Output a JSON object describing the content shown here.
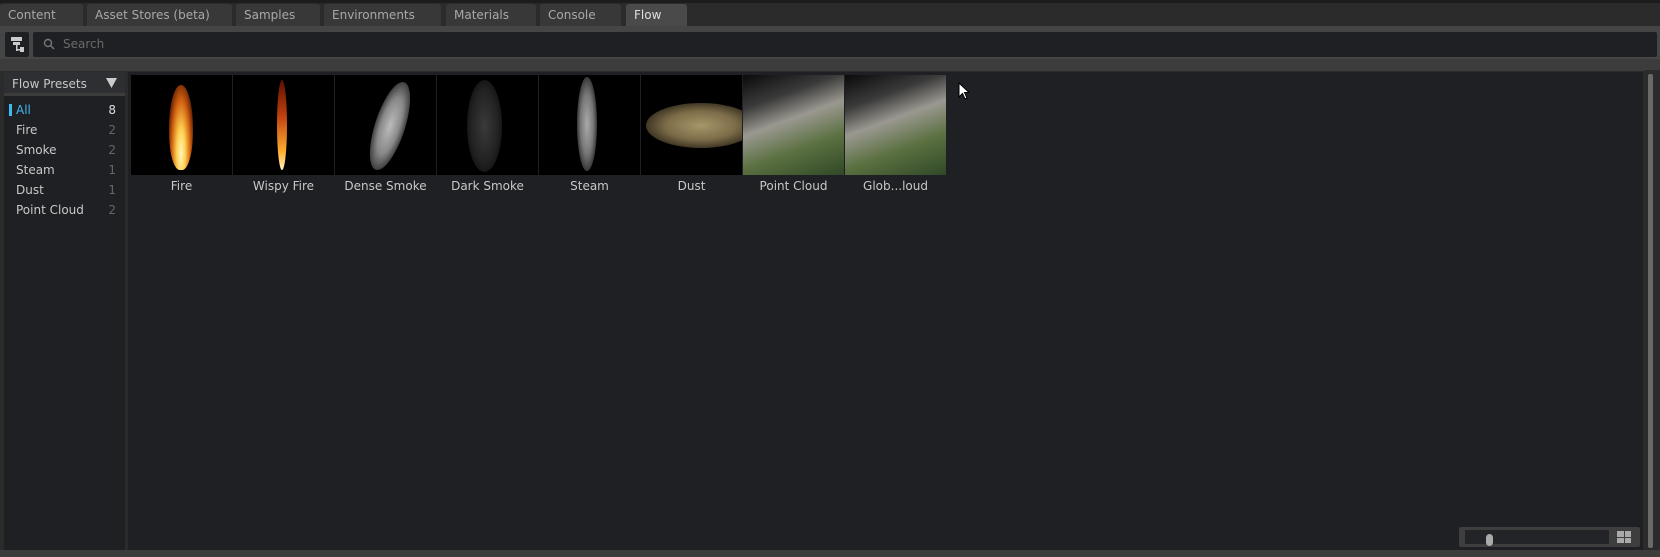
{
  "tabs": [
    {
      "label": "Content",
      "active": false
    },
    {
      "label": "Asset Stores (beta)",
      "active": false
    },
    {
      "label": "Samples",
      "active": false
    },
    {
      "label": "Environments",
      "active": false
    },
    {
      "label": "Materials",
      "active": false
    },
    {
      "label": "Console",
      "active": false
    },
    {
      "label": "Flow",
      "active": true
    }
  ],
  "search": {
    "placeholder": "Search",
    "value": ""
  },
  "sidebar": {
    "title": "Flow Presets",
    "items": [
      {
        "label": "All",
        "count": "8",
        "selected": true
      },
      {
        "label": "Fire",
        "count": "2"
      },
      {
        "label": "Smoke",
        "count": "2"
      },
      {
        "label": "Steam",
        "count": "1"
      },
      {
        "label": "Dust",
        "count": "1"
      },
      {
        "label": "Point Cloud",
        "count": "2"
      }
    ]
  },
  "presets": [
    {
      "label": "Fire",
      "thumb": "fire"
    },
    {
      "label": "Wispy Fire",
      "thumb": "wispy-fire"
    },
    {
      "label": "Dense Smoke",
      "thumb": "dense-smoke"
    },
    {
      "label": "Dark Smoke",
      "thumb": "dark-smoke"
    },
    {
      "label": "Steam",
      "thumb": "steam"
    },
    {
      "label": "Dust",
      "thumb": "dust"
    },
    {
      "label": "Point Cloud",
      "thumb": "point-cloud"
    },
    {
      "label": "Glob...loud",
      "thumb": "point-cloud"
    }
  ],
  "thumbnail_size": 0.15,
  "colors": {
    "accent": "#3fb8f0",
    "panel": "#1f2023",
    "chrome": "#454545"
  }
}
